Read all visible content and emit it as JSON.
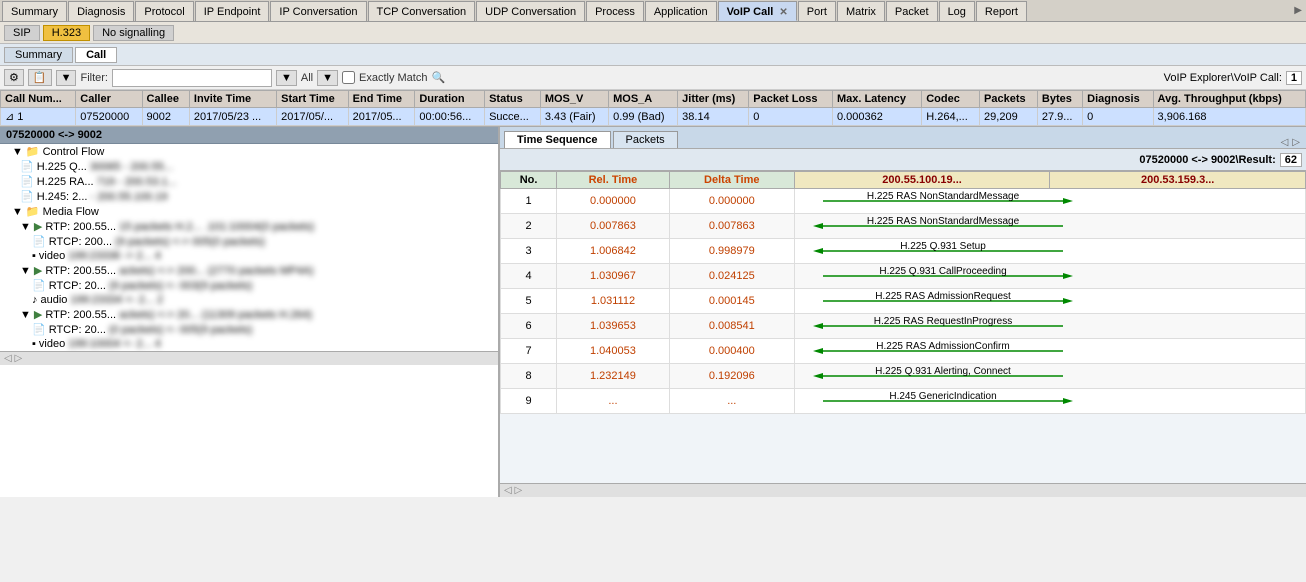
{
  "topTabs": {
    "items": [
      {
        "label": "Summary",
        "active": false
      },
      {
        "label": "Diagnosis",
        "active": false
      },
      {
        "label": "Protocol",
        "active": false
      },
      {
        "label": "IP Endpoint",
        "active": false
      },
      {
        "label": "IP Conversation",
        "active": false
      },
      {
        "label": "TCP Conversation",
        "active": false
      },
      {
        "label": "UDP Conversation",
        "active": false
      },
      {
        "label": "Process",
        "active": false
      },
      {
        "label": "Application",
        "active": false
      },
      {
        "label": "VoIP Call",
        "active": true
      },
      {
        "label": "Port",
        "active": false
      },
      {
        "label": "Matrix",
        "active": false
      },
      {
        "label": "Packet",
        "active": false
      },
      {
        "label": "Log",
        "active": false
      },
      {
        "label": "Report",
        "active": false
      }
    ]
  },
  "subTabs": {
    "items": [
      {
        "label": "SIP",
        "active": false
      },
      {
        "label": "H.323",
        "active": true,
        "highlight": true
      },
      {
        "label": "No signalling",
        "active": false
      }
    ]
  },
  "viewTabs": {
    "items": [
      {
        "label": "Summary",
        "active": false
      },
      {
        "label": "Call",
        "active": true
      }
    ]
  },
  "toolbar": {
    "filterLabel": "Filter:",
    "filterValue": "",
    "allLabel": "All",
    "exactMatchLabel": "Exactly Match",
    "voipExplorerLabel": "VoIP Explorer\\VoIP Call:",
    "voipExplorerValue": "1"
  },
  "callTable": {
    "columns": [
      "Call Num...",
      "Caller",
      "Callee",
      "Invite Time",
      "Start Time",
      "End Time",
      "Duration",
      "Status",
      "MOS_V",
      "MOS_A",
      "Jitter (ms)",
      "Packet Loss",
      "Max. Latency",
      "Codec",
      "Packets",
      "Bytes",
      "Diagnosis",
      "Avg. Throughput (kbps)"
    ],
    "rows": [
      {
        "callNum": "1",
        "caller": "07520000",
        "callee": "9002",
        "inviteTime": "2017/05/23 ...",
        "startTime": "2017/05/...",
        "endTime": "2017/05...",
        "duration": "00:00:56...",
        "status": "Succe...",
        "mos_v": "3.43 (Fair)",
        "mos_a": "0.99 (Bad)",
        "jitter": "38.14",
        "packetLoss": "0",
        "maxLatency": "0.000362",
        "codec": "H.264,...",
        "packets": "29,209",
        "bytes": "27.9...",
        "diagnosis": "0",
        "avgThroughput": "3,906.168",
        "selected": true
      }
    ]
  },
  "leftPanel": {
    "header": "07520000 <-> 9002",
    "tree": [
      {
        "level": 0,
        "expand": "▼",
        "icon": "folder",
        "label": "Control Flow"
      },
      {
        "level": 1,
        "expand": "",
        "icon": "file",
        "label": "H.225 Q...",
        "detail": "30065 - 200.55...",
        "blurred": true
      },
      {
        "level": 1,
        "expand": "",
        "icon": "file",
        "label": "H.225 RA...",
        "detail": "719 - 200.53.1...",
        "blurred": true
      },
      {
        "level": 1,
        "expand": "",
        "icon": "file",
        "label": "H.245: 2...",
        "detail": "- 200.55.100.19",
        "blurred": true
      },
      {
        "level": 0,
        "expand": "▼",
        "icon": "folder",
        "label": "Media Flow"
      },
      {
        "level": 1,
        "expand": "▼",
        "icon": "rtp",
        "label": "RTP: 200.55...",
        "detail": "15 packets H.2...",
        "detail2": ".101:10004(0 packets)",
        "blurred": true
      },
      {
        "level": 2,
        "expand": "",
        "icon": "file",
        "label": "RTCP: 200...",
        "detail": "(9 packets) <->",
        "detail2": "005(0 packets)",
        "blurred": true
      },
      {
        "level": 2,
        "expand": "",
        "icon": "file",
        "label": "▪ video",
        "detail": "199:23336 -> 2...",
        "detail2": "4",
        "blurred": true
      },
      {
        "level": 1,
        "expand": "▼",
        "icon": "rtp",
        "label": "RTP: 200.55...",
        "detail": "ackets) <-> 200...",
        "detail2": "(2770 packets MP4A)",
        "blurred": true
      },
      {
        "level": 2,
        "expand": "",
        "icon": "file",
        "label": "RTCP: 20...",
        "detail": "(9 packets) <-",
        "detail2": "003(9 packets)",
        "blurred": true
      },
      {
        "level": 2,
        "expand": "",
        "icon": "file",
        "label": "♪ audio",
        "detail": "199:23334 <- 2...",
        "detail2": "2",
        "blurred": true
      },
      {
        "level": 1,
        "expand": "▼",
        "icon": "rtp",
        "label": "RTP: 200.55...",
        "detail": "ackets) <-> 20...",
        "detail2": "(11309 packets H.264)",
        "blurred": true
      },
      {
        "level": 2,
        "expand": "",
        "icon": "file",
        "label": "RTCP: 20...",
        "detail": "(0 packets) <-",
        "detail2": "005(9 packets)",
        "blurred": true
      },
      {
        "level": 2,
        "expand": "",
        "icon": "file",
        "label": "▪ video",
        "detail": "199:10004 <- 2...",
        "detail2": "4",
        "blurred": true
      }
    ]
  },
  "rightPanel": {
    "tabs": [
      {
        "label": "Time Sequence",
        "active": true
      },
      {
        "label": "Packets",
        "active": false
      }
    ],
    "header": {
      "label": "07520000 <-> 9002\\Result:",
      "value": "62"
    },
    "timeSequence": {
      "columns": {
        "no": "No.",
        "relTime": "Rel. Time",
        "deltaTime": "Delta Time",
        "ip1": "200.55.100.19...",
        "ip2": "200.53.159.3..."
      },
      "rows": [
        {
          "no": "1",
          "relTime": "0.000000",
          "deltaTime": "0.000000",
          "msg": "H.225 RAS NonStandardMessage",
          "direction": "right"
        },
        {
          "no": "2",
          "relTime": "0.007863",
          "deltaTime": "0.007863",
          "msg": "H.225 RAS NonStandardMessage",
          "direction": "left"
        },
        {
          "no": "3",
          "relTime": "1.006842",
          "deltaTime": "0.998979",
          "msg": "H.225 Q.931 Setup",
          "direction": "left"
        },
        {
          "no": "4",
          "relTime": "1.030967",
          "deltaTime": "0.024125",
          "msg": "H.225 Q.931 CallProceeding",
          "direction": "right"
        },
        {
          "no": "5",
          "relTime": "1.031112",
          "deltaTime": "0.000145",
          "msg": "H.225 RAS AdmissionRequest",
          "direction": "right"
        },
        {
          "no": "6",
          "relTime": "1.039653",
          "deltaTime": "0.008541",
          "msg": "H.225 RAS RequestInProgress",
          "direction": "left"
        },
        {
          "no": "7",
          "relTime": "1.040053",
          "deltaTime": "0.000400",
          "msg": "H.225 RAS AdmissionConfirm",
          "direction": "left"
        },
        {
          "no": "8",
          "relTime": "1.232149",
          "deltaTime": "0.192096",
          "msg": "H.225 Q.931 Alerting, Connect",
          "direction": "left"
        },
        {
          "no": "9",
          "relTime": "...",
          "deltaTime": "...",
          "msg": "H.245 GenericIndication",
          "direction": "right"
        }
      ]
    }
  }
}
